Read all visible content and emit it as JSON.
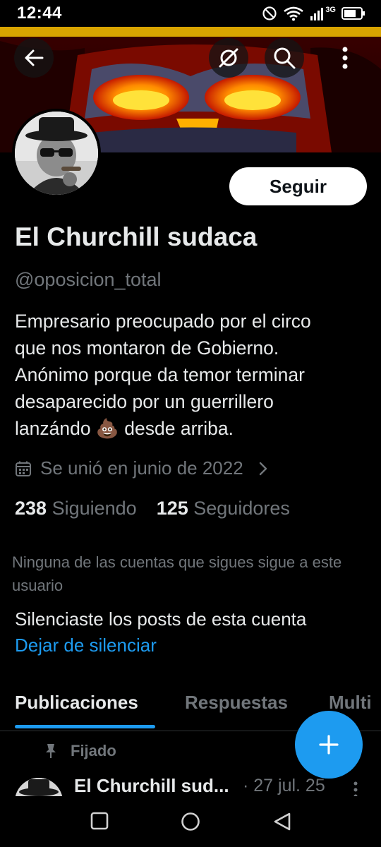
{
  "status_bar": {
    "time": "12:44",
    "icons": [
      "do-not-disturb-icon",
      "wifi-icon",
      "signal-icon",
      "network-3g",
      "battery-icon"
    ],
    "network_label": "3G"
  },
  "header": {
    "back_icon": "arrow-left-icon",
    "grok_icon": "grok-icon",
    "search_icon": "search-icon",
    "more_icon": "more-vertical-icon"
  },
  "profile": {
    "follow_label": "Seguir",
    "name": "El Churchill sudaca",
    "handle": "@oposicion_total",
    "bio_lines": [
      "Empresario preocupado por el circo",
      "que nos montaron de Gobierno.",
      "Anónimo porque da temor terminar",
      "desaparecido por un guerrillero",
      "lanzándo 💩 desde arriba."
    ],
    "joined": "Se unió en junio de 2022",
    "following_count": "238",
    "following_label": "Siguiendo",
    "followers_count": "125",
    "followers_label": "Seguidores",
    "no_mutuals": "Ninguna de las cuentas que sigues sigue a este usuario",
    "muted_notice": "Silenciaste los posts de esta cuenta",
    "unmute_label": "Dejar de silenciar"
  },
  "tabs": [
    {
      "label": "Publicaciones",
      "active": true
    },
    {
      "label": "Respuestas",
      "active": false
    },
    {
      "label": "Multi",
      "active": false
    }
  ],
  "pinned_post": {
    "pinned_label": "Fijado",
    "author": "El Churchill sud...",
    "date": "· 27 jul. 25"
  },
  "fab": {
    "icon": "plus-icon"
  },
  "nav_bar": {
    "icons": [
      "recent-apps-icon",
      "home-icon",
      "back-triangle-icon"
    ]
  },
  "colors": {
    "accent": "#1d9bf0",
    "background": "#000000",
    "text_primary": "#e7e9ea",
    "text_secondary": "#71767b"
  }
}
